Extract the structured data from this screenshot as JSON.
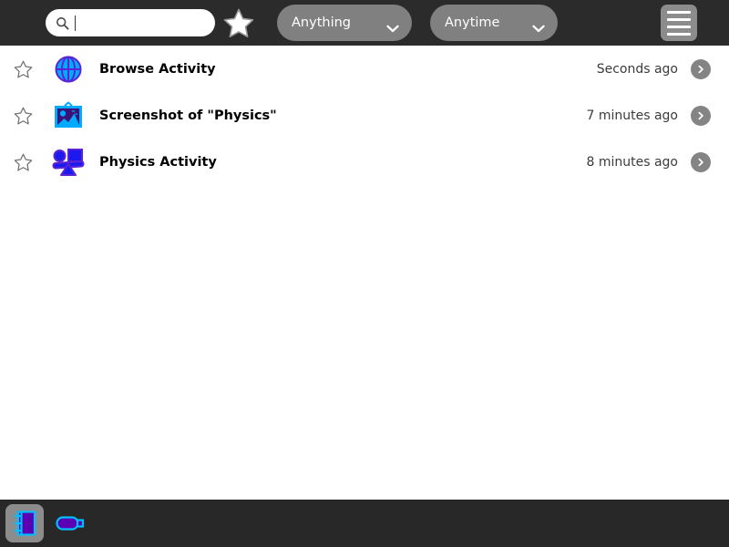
{
  "window": {
    "title": "Journal"
  },
  "toolbar": {
    "search": {
      "placeholder": "",
      "value": "",
      "icon": "search-icon"
    },
    "favorite_filter": {
      "label": "Favorites",
      "icon": "star-icon",
      "active": false
    },
    "kind_filter": {
      "selected": "Anything",
      "icon": "chevron-down-icon",
      "options": [
        "Anything"
      ]
    },
    "time_filter": {
      "selected": "Anytime",
      "icon": "chevron-down-icon",
      "options": [
        "Anytime"
      ]
    },
    "view_toggle": {
      "label": "List view",
      "icon": "list-view-icon"
    },
    "colors": {
      "background": "#2b2b2b",
      "control": "#808080",
      "button": "#8c8c8c"
    }
  },
  "entries": [
    {
      "favorite": false,
      "favorite_icon": "star-outline-icon",
      "icon": "globe-icon",
      "icon_fill": "#00b4ff",
      "icon_stroke": "#5b23d6",
      "title": "Browse Activity",
      "time": "Seconds ago",
      "detail_icon": "chevron-right-icon"
    },
    {
      "favorite": false,
      "favorite_icon": "star-outline-icon",
      "icon": "image-icon",
      "icon_fill": "#00b4ff",
      "icon_stroke": "#5b23d6",
      "title": "Screenshot of \"Physics\"",
      "time": "7 minutes ago",
      "detail_icon": "chevron-right-icon"
    },
    {
      "favorite": false,
      "favorite_icon": "star-outline-icon",
      "icon": "physics-icon",
      "icon_fill": "#1a1aee",
      "icon_stroke": "#5b23d6",
      "title": "Physics Activity",
      "time": "8 minutes ago",
      "detail_icon": "chevron-right-icon"
    }
  ],
  "frame_bar": {
    "background": "#282828",
    "items": [
      {
        "name": "journal",
        "label": "Journal",
        "icon": "journal-icon",
        "active": true,
        "fill": "#5b00b4",
        "stroke": "#00bfff"
      },
      {
        "name": "usb-drive",
        "label": "USB Drive",
        "icon": "usb-drive-icon",
        "active": false,
        "fill": "#5b00b4",
        "stroke": "#00bfff"
      }
    ]
  }
}
